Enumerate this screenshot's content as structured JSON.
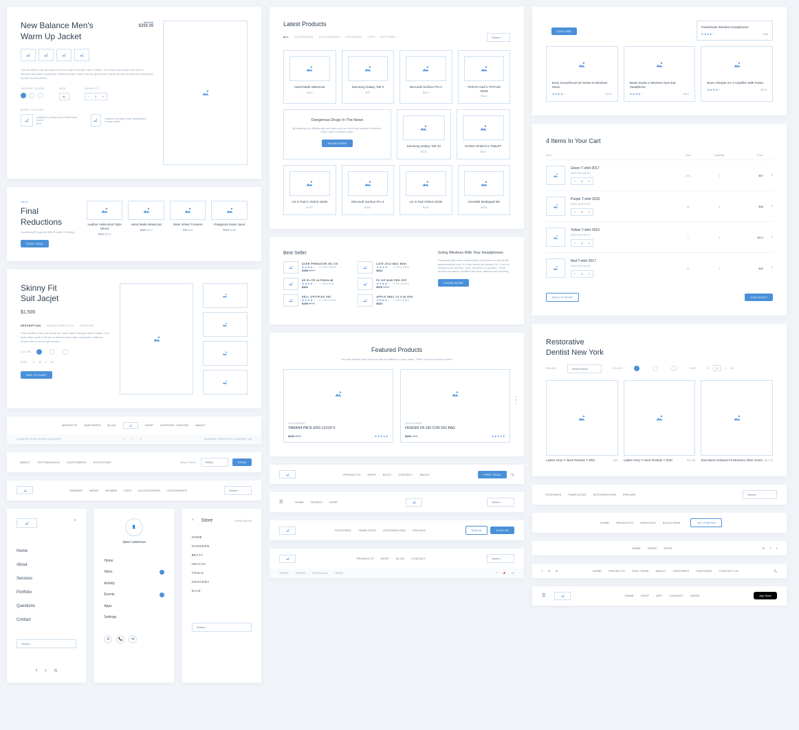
{
  "c1_product": {
    "title": "New Balance Men's\nWarm Up Jacket",
    "old_price": "$429.00",
    "price": "$399.99",
    "desc": "The condition may not cause too much harm if proper care is taken. You body takes quite a bit due to diarrhea and other symptoms. Without proper care it can be get severe. Adults as well as kids are not spared by this inconvenience.",
    "labels": {
      "color": "CHOOSE COLOR",
      "size": "SIZE",
      "qty": "QUANTITY",
      "more": "MORE CHOICES"
    },
    "qty": "1",
    "size": "XL",
    "more": [
      {
        "name": "LaBellum by Hillary Scott Printed Moto Jacket",
        "price": "$129"
      },
      {
        "name": "LaBellum by Hillary Scott Handbeaded Canvas Jacket",
        "price": ""
      }
    ]
  },
  "c1_final": {
    "badge": "SALE",
    "title": "Final Reductions",
    "sub": "Increasing Prosperity With Positive Thinking",
    "btn": "SHOP NOW",
    "items": [
      {
        "name": "Leather Ankle Boot Style Shoes",
        "old": "$210",
        "price": "$170"
      },
      {
        "name": "Hand Made Waistcoat",
        "old": "$150",
        "price": "$110"
      },
      {
        "name": "Wide Velvet Trousers",
        "old": "$60",
        "price": "$46"
      },
      {
        "name": "Patagonia Down Jacet",
        "old": "$200",
        "price": "$180"
      }
    ]
  },
  "c1_skinny": {
    "title": "Skinny Fit\nSuit Jacjet",
    "price": "$1,500",
    "tabs": [
      "DESCRIPTION",
      "CHARACTERISTICS",
      "SHIPPING"
    ],
    "desc": "This condition may not cause too much harm if proper care is taken. You body takes quite a bit due to diarrhea and other symptoms. Without proper care it can be get severe.",
    "color_label": "COLOR",
    "size_label": "SIZE",
    "sizes": [
      "S",
      "M",
      "L",
      "XL"
    ],
    "btn": "ADD TO CART"
  },
  "c1_nav1": {
    "links": [
      "BENEFITS",
      "PARTNERS",
      "BLOG",
      "",
      "SHOP",
      "SUPPORT CENTER",
      "ABOUT"
    ],
    "footL": "COUNTRY   OUR SHOES   DELIVERY",
    "footR": "PAYMENT   PORTFOLIO  CONTACT US"
  },
  "c1_nav2": {
    "links": [
      "ABOUT",
      "TESTIMONIALS",
      "CUSTOMERS",
      "SOLUTIONS"
    ],
    "stay": "Stay in Touch",
    "email": "EMAIL",
    "btn": "SEND"
  },
  "c1_nav3": {
    "links": [
      "BRANDS",
      "MENU",
      "WOMEN",
      "KIDS",
      "ACCESSORIES",
      "CATEGORIES"
    ],
    "search": "Search"
  },
  "c1_sidemenu": {
    "items": [
      "Home",
      "About",
      "Services",
      "Portfolio",
      "Questions",
      "Contact"
    ],
    "search": "Search"
  },
  "c1_profile": {
    "name": "Jane Lawrence",
    "items": [
      "Home",
      "Inbox",
      "Activity",
      "Events",
      "Apps",
      "Settings"
    ]
  },
  "c1_store": {
    "title": "Store",
    "count": "3 items",
    "total": "($204)",
    "cats": [
      "HOME",
      "GARDERN",
      "BEATY",
      "HEALTH",
      "TOOLS",
      "GROCERY",
      "SALE"
    ],
    "search": "Search"
  },
  "c2_latest": {
    "title": "Latest Products",
    "filters": [
      "ALL",
      "OUTERWEAR",
      "ACCESSORIES",
      "FOOTWEAR",
      "TOPS",
      "BOTTOMS"
    ],
    "search": "Search",
    "items": [
      {
        "name": "Hand Made Waistcoat",
        "price": "$110"
      },
      {
        "name": "Samsung Galaxy Tab 3",
        "price": "$75"
      },
      {
        "name": "Microsoft Surface Pro 3",
        "price": "$411"
      },
      {
        "name": "TESCO Hudl 2 HTFA4D 16GB",
        "price": "$110"
      }
    ],
    "promo": {
      "title": "Dangerous Drugs In The News",
      "desc": "By keeping your kitchen apn and open you can avoid any causes of infection. Drink boiled or bottled water.",
      "btn": "SHOW MORE"
    },
    "items2": [
      {
        "name": "Samsung Galaxy Tab S2",
        "price": "$610"
      },
      {
        "name": "NVIDIA Shield K1 TABLET",
        "price": "$610"
      }
    ],
    "items3": [
      {
        "name": "LG G Pad X VK815 16GB",
        "price": "$178"
      },
      {
        "name": "Microsoft Surface Pro 4",
        "price": "$542"
      },
      {
        "name": "LG G Pad VK810 16GB",
        "price": "$410"
      },
      {
        "name": "HUAWBI Mediapad M3",
        "price": "$310"
      }
    ]
  },
  "c2_bestseller": {
    "title": "Best Seller",
    "sidebar": {
      "title": "Going Wireless With Your Headphones",
      "desc": "Gastroenteritis means inflammation of stomach as well as the gastrointestinal tract. It is also known as stomach flu. It can be caused by an infection, virus, bacterium or parasite. These viruses can lead to condition like fever, diarrhea and vomiting.",
      "btn": "LEARN MORE"
    },
    "left": [
      {
        "name": "ACER PREDATOR G6-710",
        "reviews": "12 Reviews",
        "price": "$199",
        "old": "$270"
      },
      {
        "name": "HP ELITE ULTRASLIM",
        "reviews": ".1 Review",
        "price": "$462"
      },
      {
        "name": "DELL OPTIPLEX 982",
        "reviews": "11 Reviews",
        "price": "$199",
        "old": "$249"
      }
    ],
    "right": [
      {
        "name": "LATE 2012 MAC MINI",
        "reviews": "0 Reviews",
        "price": "$261"
      },
      {
        "name": "PC HP 6300 PRO SFF",
        "reviews": "0 Reviews",
        "price": "$370",
        "old": "$310"
      },
      {
        "name": "APPLE IMAC 24 3.06 GHZ",
        "reviews": "4 Reviews",
        "price": "$622"
      }
    ]
  },
  "c2_featured": {
    "title": "Featured Products",
    "sub": "You also endure body ache as well as stiffness of your joints. There is a lack of stool control.",
    "items": [
      {
        "cat": "GUITARRAS",
        "name": "YAMAHA PACK ERG-121GP II",
        "price": "$199",
        "old": "$280"
      },
      {
        "cat": "GUITARRAS",
        "name": "FENDER FA-100 CON GIG BAG",
        "price": "$352",
        "old": "$490"
      }
    ]
  },
  "c2_nav1": {
    "links": [
      "Products",
      "Shop",
      "Blog",
      "Contact",
      "About"
    ],
    "btn": "FREE TRIAL"
  },
  "c2_nav2": {
    "links": [
      "HOME",
      "WORKS",
      "SHOP"
    ],
    "search": "Search"
  },
  "c2_nav3": {
    "links": [
      "FEATURES",
      "TEMPLATES",
      "INTEGRATIONS",
      "PRICING"
    ],
    "signin": "SIGN IN",
    "signup": "SIGN UP"
  },
  "c2_nav4": {
    "links": [
      "PRODUCTS",
      "SHOP",
      "BLOG",
      "CONTACT"
    ],
    "search": "Search",
    "foot": [
      "Terms",
      "Promo",
      "Download",
      "News"
    ]
  },
  "c3_audio": {
    "btn": "EXPLORE",
    "promo": {
      "name": "Powerbeats Wireless Headphones",
      "price": "$98"
    },
    "items": [
      {
        "name": "Bose SoundTouch 20 Series III Wireless Music",
        "price": "$174"
      },
      {
        "name": "Beats Studio 2 Wireless Over-Ear Headphone",
        "price": "$111"
      },
      {
        "name": "Bose Lifestyle SA-3 Amplifier With Power",
        "price": "$190"
      }
    ]
  },
  "c3_cart": {
    "title": "4 Items In Your Cart",
    "headers": [
      "Item",
      "Size",
      "Quantity",
      "Price"
    ],
    "items": [
      {
        "name": "Green T-shirt 2017",
        "sku": "Man B433EZF",
        "size": "XXL",
        "qty": "1",
        "price": "$37"
      },
      {
        "name": "Purple T-shirt 2016",
        "sku": "Man B433ASZ",
        "size": "XL",
        "qty": "2",
        "price": "$48"
      },
      {
        "name": "Yellow T-shirt 2016",
        "sku": "Man B433EZF",
        "size": "L",
        "qty": "2",
        "price": "$112"
      },
      {
        "name": "Red T-shirt 2017",
        "sku": "Man B433A4S",
        "size": "XL",
        "qty": "1",
        "price": "$42"
      }
    ],
    "back": "BACK TO SHOP",
    "checkout": "CHECKOUT"
  },
  "c3_dentist": {
    "title": "Restorative\nDentist New York",
    "brand": "BRAND",
    "brand_ph": "Select Brand",
    "color": "COLOR",
    "size": "SIZE",
    "sizes": [
      "S",
      "M",
      "L",
      "XL"
    ],
    "items": [
      {
        "name": "Ladies Grey V Neck Reebok T Shirt",
        "price": "$49"
      },
      {
        "name": "Ladies Grey V Neck Reebok T Shirt",
        "price": "$37.99"
      },
      {
        "name": "Zara Basic Relaxed Fit Womens Olive Green",
        "price": "$67.99"
      }
    ]
  },
  "c3_nav1": {
    "links": [
      "FEATURES",
      "TEMPLATES",
      "INTEGRATIONS",
      "PRICING"
    ],
    "search": "Search"
  },
  "c3_nav2": {
    "links": [
      "HOME",
      "PRODUCTS",
      "SERVICES",
      "SOLUTIONS"
    ],
    "btn": "GET STARTED"
  },
  "c3_nav3": {
    "links": [
      "HOME",
      "NEWS",
      "SHOP"
    ]
  },
  "c3_nav4": {
    "links": [
      "HOME",
      "PROJECTS",
      "OUR CREW",
      "ABOUT",
      "FEATURES",
      "FEATURES",
      "CONTACT US"
    ]
  },
  "c3_nav5": {
    "links": [
      "HOME",
      "SHOP",
      "APP",
      "CONTACT",
      "NEWS"
    ],
    "appstore": "App Store"
  }
}
